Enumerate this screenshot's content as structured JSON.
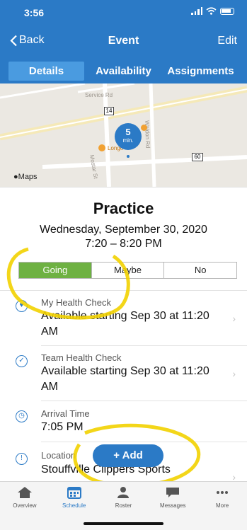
{
  "status_bar": {
    "time": "3:56"
  },
  "nav": {
    "back_label": "Back",
    "title": "Event",
    "edit_label": "Edit"
  },
  "tabs": [
    {
      "label": "Details",
      "active": true
    },
    {
      "label": "Availability",
      "active": false
    },
    {
      "label": "Assignments",
      "active": false
    }
  ],
  "map": {
    "roads": [
      "Service Rd",
      "Mostar St",
      "Waldon Rd"
    ],
    "shield_14": "14",
    "shield_60": "60",
    "place": "Longo",
    "marker_number": "5",
    "marker_unit": "min.",
    "attribution": "Maps"
  },
  "event": {
    "title": "Practice",
    "date": "Wednesday, September 30, 2020",
    "time": "7:20 – 8:20 PM"
  },
  "rsvp": {
    "options": [
      "Going",
      "Maybe",
      "No"
    ],
    "selected": "Going"
  },
  "details": [
    {
      "label": "My Health Check",
      "value": "Available starting Sep 30 at 11:20 AM",
      "icon": "heart-icon"
    },
    {
      "label": "Team Health Check",
      "value": "Available starting Sep 30 at 11:20 AM",
      "icon": "check-circle-icon"
    },
    {
      "label": "Arrival Time",
      "value": "7:05 PM",
      "icon": "clock-icon"
    },
    {
      "label": "Location",
      "value": "Stouffville Clippers Sports",
      "icon": "location-pin-icon"
    }
  ],
  "add_button": {
    "label": "+ Add"
  },
  "tabbar": [
    {
      "label": "Overview",
      "icon": "home-icon",
      "active": false
    },
    {
      "label": "Schedule",
      "icon": "calendar-icon",
      "active": true
    },
    {
      "label": "Roster",
      "icon": "people-icon",
      "active": false
    },
    {
      "label": "Messages",
      "icon": "chat-bubble-icon",
      "active": false
    },
    {
      "label": "More",
      "icon": "more-dots-icon",
      "active": false
    }
  ],
  "colors": {
    "brand": "#2b7ac6",
    "going": "#6eb142",
    "highlighter": "#f2d100"
  }
}
